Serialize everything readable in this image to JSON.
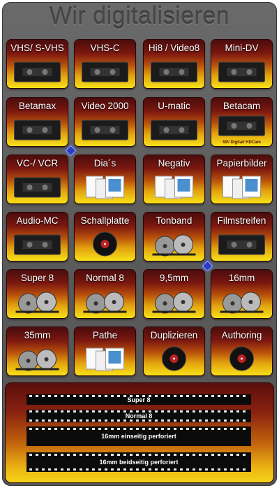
{
  "title": "Wir digitalisieren",
  "tiles": [
    {
      "label": "VHS/ S-VHS",
      "icon": "vhs-cassette-icon"
    },
    {
      "label": "VHS-C",
      "icon": "vhsc-cassette-icon"
    },
    {
      "label": "Hi8 / Video8",
      "icon": "hi8-cassette-icon"
    },
    {
      "label": "Mini-DV",
      "icon": "minidv-cassette-icon"
    },
    {
      "label": "Betamax",
      "icon": "betamax-cassette-icon"
    },
    {
      "label": "Video 2000",
      "icon": "video2000-cassette-icon"
    },
    {
      "label": "U-matic",
      "icon": "umatic-cassette-icon"
    },
    {
      "label": "Betacam",
      "icon": "betacam-cassette-icon",
      "sub": "SP/ Digital/ HDCam"
    },
    {
      "label": "VC-/ VCR",
      "icon": "vcr-cassette-icon"
    },
    {
      "label": "Dia´s",
      "icon": "slides-icon"
    },
    {
      "label": "Negativ",
      "icon": "negative-photo-icon"
    },
    {
      "label": "Papierbilder",
      "icon": "paper-photos-icon"
    },
    {
      "label": "Audio-MC",
      "icon": "audio-cassette-icon"
    },
    {
      "label": "Schallplatte",
      "icon": "vinyl-record-icon"
    },
    {
      "label": "Tonband",
      "icon": "tape-reel-icon"
    },
    {
      "label": "Filmstreifen",
      "icon": "film-strip-icon"
    },
    {
      "label": "Super 8",
      "icon": "super8-reels-icon"
    },
    {
      "label": "Normal 8",
      "icon": "normal8-reel-icon"
    },
    {
      "label": "9,5mm",
      "icon": "film-cans-icon"
    },
    {
      "label": "16mm",
      "icon": "film-reel-16mm-icon"
    },
    {
      "label": "35mm",
      "icon": "film-reel-35mm-icon"
    },
    {
      "label": "Pathe",
      "icon": "pathe-logo-icon"
    },
    {
      "label": "Duplizieren",
      "icon": "disc-stack-icon"
    },
    {
      "label": "Authoring",
      "icon": "authoring-disc-icon"
    }
  ],
  "strips": [
    {
      "label": "Super 8"
    },
    {
      "label": "Normal 8"
    },
    {
      "label": "16mm einseitig perforiert"
    },
    {
      "label": "16mm beidseitig perforiert"
    }
  ],
  "colors": {
    "panel": "#5b5b5b",
    "tile_top": "#4a0c0c",
    "tile_bottom": "#f7e21a",
    "gem": "#2a3cc0"
  }
}
